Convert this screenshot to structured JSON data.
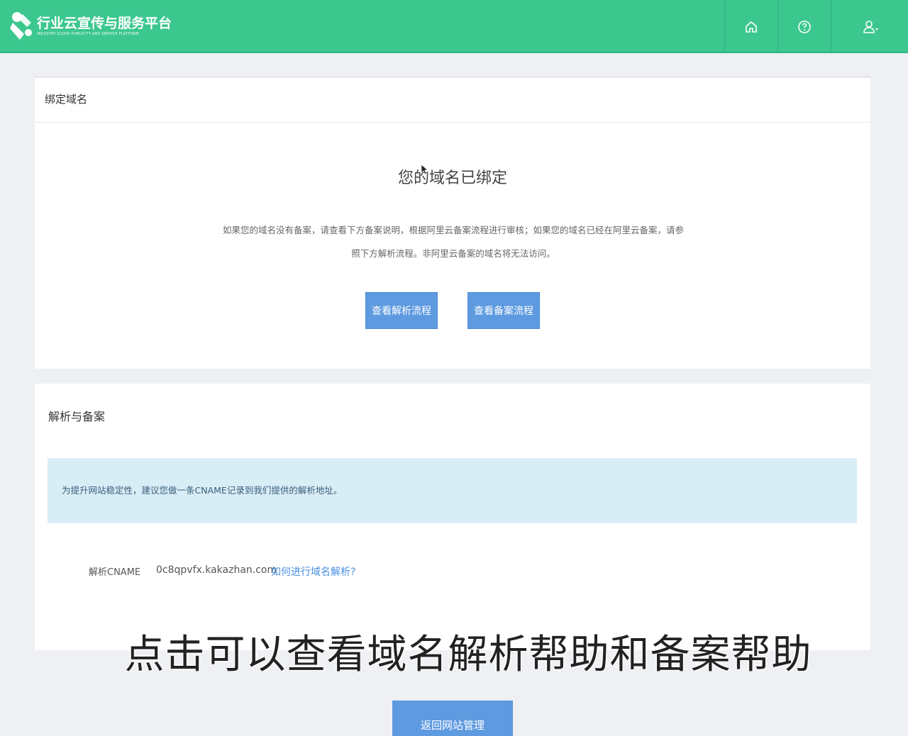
{
  "header": {
    "logo_title": "行业云宣传与服务平台",
    "logo_subtitle": "INDUSTRY CLOUD PUBLICITY AND SERVICE PLATFORM",
    "nav": [
      {
        "icon": "home-icon"
      },
      {
        "icon": "help-icon"
      },
      {
        "icon": "user-icon"
      }
    ],
    "brand_color": "#3cc78f"
  },
  "bind_panel": {
    "title": "绑定域名",
    "status_title": "您的域名已绑定",
    "description": "如果您的域名没有备案，请查看下方备案说明，根据阿里云备案流程进行审核；如果您的域名已经在阿里云备案，请参照下方解析流程。非阿里云备案的域名将无法访问。",
    "btn_view_resolve": "查看解析流程",
    "btn_view_record": "查看备案流程"
  },
  "resolve_panel": {
    "title": "解析与备案",
    "notice": "为提升网站稳定性，建议您做一条CNAME记录到我们提供的解析地址。",
    "cname_label": "解析CNAME",
    "cname_value": "0c8qpvfx.kakazhan.com",
    "cname_help_link": "如何进行域名解析?"
  },
  "footer": {
    "back_button": "返回网站管理"
  },
  "subtitle": "点击可以查看域名解析帮助和备案帮助",
  "colors": {
    "accent_button": "#5e9ae0",
    "info_bg": "#d9edf7",
    "link": "#4a90e2"
  }
}
